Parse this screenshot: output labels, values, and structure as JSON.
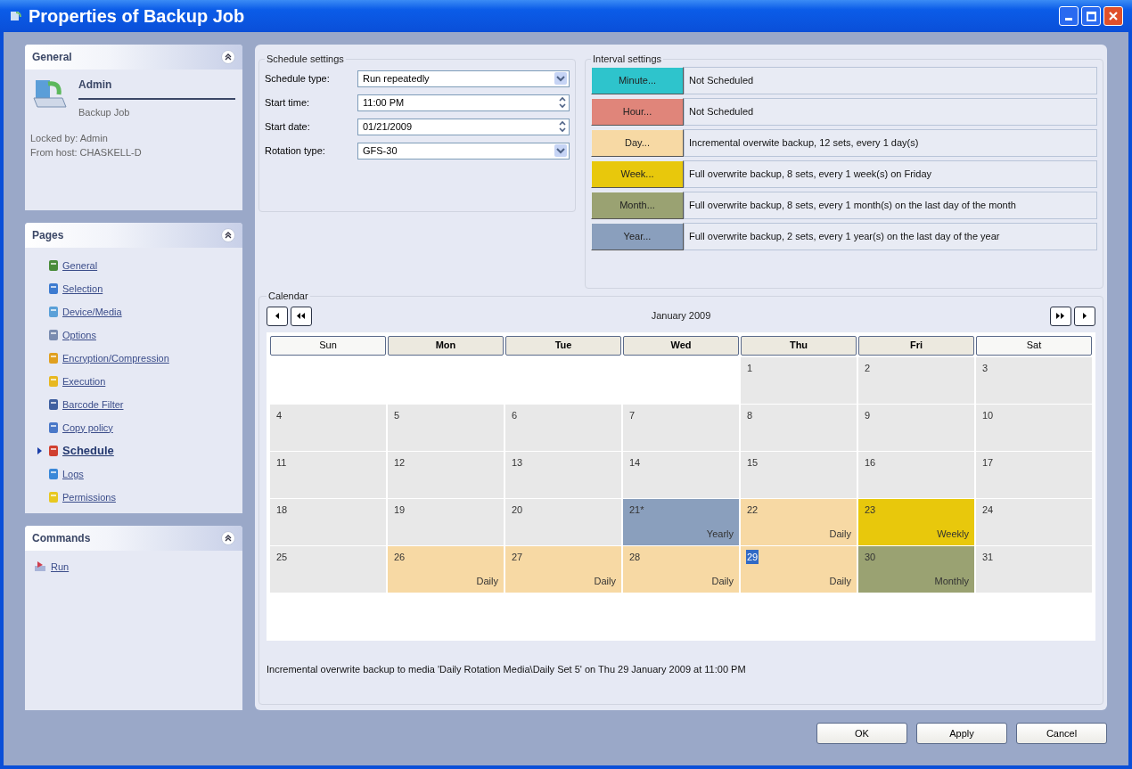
{
  "window": {
    "title": "Properties of Backup Job"
  },
  "sidebar": {
    "general": {
      "title": "General",
      "name": "Admin",
      "subtitle": "Backup Job",
      "info": [
        "Locked by: Admin",
        "From host: CHASKELL-D"
      ]
    },
    "pages": {
      "title": "Pages",
      "items": [
        {
          "label": "General",
          "selected": false
        },
        {
          "label": "Selection",
          "selected": false
        },
        {
          "label": "Device/Media",
          "selected": false
        },
        {
          "label": "Options",
          "selected": false
        },
        {
          "label": "Encryption/Compression",
          "selected": false
        },
        {
          "label": "Execution",
          "selected": false
        },
        {
          "label": "Barcode Filter",
          "selected": false
        },
        {
          "label": "Copy policy",
          "selected": false
        },
        {
          "label": "Schedule",
          "selected": true
        },
        {
          "label": "Logs",
          "selected": false
        },
        {
          "label": "Permissions",
          "selected": false
        }
      ]
    },
    "commands": {
      "title": "Commands",
      "items": [
        {
          "label": "Run"
        }
      ]
    }
  },
  "schedule_settings": {
    "title": "Schedule settings",
    "fields": [
      {
        "label": "Schedule type:",
        "value": "Run repeatedly",
        "kind": "dropdown"
      },
      {
        "label": "Start time:",
        "value": "11:00 PM",
        "kind": "spinner"
      },
      {
        "label": "Start date:",
        "value": "01/21/2009",
        "kind": "spinner"
      },
      {
        "label": "Rotation type:",
        "value": "GFS-30",
        "kind": "dropdown"
      }
    ]
  },
  "interval_settings": {
    "title": "Interval settings",
    "rows": [
      {
        "button": "Minute...",
        "color": "#2ec4cc",
        "description": "Not Scheduled"
      },
      {
        "button": "Hour...",
        "color": "#e0857a",
        "description": "Not Scheduled"
      },
      {
        "button": "Day...",
        "color": "#f7d9a4",
        "description": "Incremental overwite backup, 12 sets, every 1 day(s)"
      },
      {
        "button": "Week...",
        "color": "#e8c80c",
        "description": "Full overwrite backup, 8 sets, every 1 week(s) on Friday"
      },
      {
        "button": "Month...",
        "color": "#9aa272",
        "description": "Full overwrite backup, 8 sets, every 1 month(s) on the last day of the month"
      },
      {
        "button": "Year...",
        "color": "#8a9fbd",
        "description": "Full overwrite backup, 2 sets, every 1 year(s) on the last day of the year"
      }
    ]
  },
  "calendar": {
    "title": "Calendar",
    "month": "January 2009",
    "weekdays": [
      {
        "label": "Sun",
        "kind": "weekend"
      },
      {
        "label": "Mon",
        "kind": "workday"
      },
      {
        "label": "Tue",
        "kind": "workday"
      },
      {
        "label": "Wed",
        "kind": "workday"
      },
      {
        "label": "Thu",
        "kind": "workday"
      },
      {
        "label": "Fri",
        "kind": "workday"
      },
      {
        "label": "Sat",
        "kind": "weekend"
      }
    ],
    "weeks": [
      [
        {
          "kind": "blank"
        },
        {
          "kind": "blank"
        },
        {
          "kind": "blank"
        },
        {
          "kind": "blank"
        },
        {
          "kind": "day",
          "day": "1",
          "selected": false
        },
        {
          "kind": "day",
          "day": "2",
          "selected": false
        },
        {
          "kind": "day",
          "day": "3",
          "selected": false
        }
      ],
      [
        {
          "kind": "day",
          "day": "4",
          "selected": false
        },
        {
          "kind": "day",
          "day": "5",
          "selected": false
        },
        {
          "kind": "day",
          "day": "6",
          "selected": false
        },
        {
          "kind": "day",
          "day": "7",
          "selected": false
        },
        {
          "kind": "day",
          "day": "8",
          "selected": false
        },
        {
          "kind": "day",
          "day": "9",
          "selected": false
        },
        {
          "kind": "day",
          "day": "10",
          "selected": false
        }
      ],
      [
        {
          "kind": "day",
          "day": "11",
          "selected": false
        },
        {
          "kind": "day",
          "day": "12",
          "selected": false
        },
        {
          "kind": "day",
          "day": "13",
          "selected": false
        },
        {
          "kind": "day",
          "day": "14",
          "selected": false
        },
        {
          "kind": "day",
          "day": "15",
          "selected": false
        },
        {
          "kind": "day",
          "day": "16",
          "selected": false
        },
        {
          "kind": "day",
          "day": "17",
          "selected": false
        }
      ],
      [
        {
          "kind": "day",
          "day": "18",
          "selected": false
        },
        {
          "kind": "day",
          "day": "19",
          "selected": false
        },
        {
          "kind": "day",
          "day": "20",
          "selected": false
        },
        {
          "kind": "day",
          "day": "21*",
          "selected": false,
          "label": "Yearly",
          "color": "#8a9fbd"
        },
        {
          "kind": "day",
          "day": "22",
          "selected": false,
          "label": "Daily",
          "color": "#f7d9a4"
        },
        {
          "kind": "day",
          "day": "23",
          "selected": false,
          "label": "Weekly",
          "color": "#e8c80c"
        },
        {
          "kind": "day",
          "day": "24",
          "selected": false
        }
      ],
      [
        {
          "kind": "day",
          "day": "25",
          "selected": false
        },
        {
          "kind": "day",
          "day": "26",
          "selected": false,
          "label": "Daily",
          "color": "#f7d9a4"
        },
        {
          "kind": "day",
          "day": "27",
          "selected": false,
          "label": "Daily",
          "color": "#f7d9a4"
        },
        {
          "kind": "day",
          "day": "28",
          "selected": false,
          "label": "Daily",
          "color": "#f7d9a4"
        },
        {
          "kind": "day",
          "day": "29",
          "selected": true,
          "label": "Daily",
          "color": "#f7d9a4"
        },
        {
          "kind": "day",
          "day": "30",
          "selected": false,
          "label": "Monthly",
          "color": "#9aa272"
        },
        {
          "kind": "day",
          "day": "31",
          "selected": false
        }
      ]
    ],
    "status": "Incremental overwrite backup to media 'Daily Rotation Media\\Daily Set 5' on Thu 29 January 2009 at 11:00 PM"
  },
  "buttons": [
    {
      "label": "OK"
    },
    {
      "label": "Apply"
    },
    {
      "label": "Cancel"
    }
  ]
}
